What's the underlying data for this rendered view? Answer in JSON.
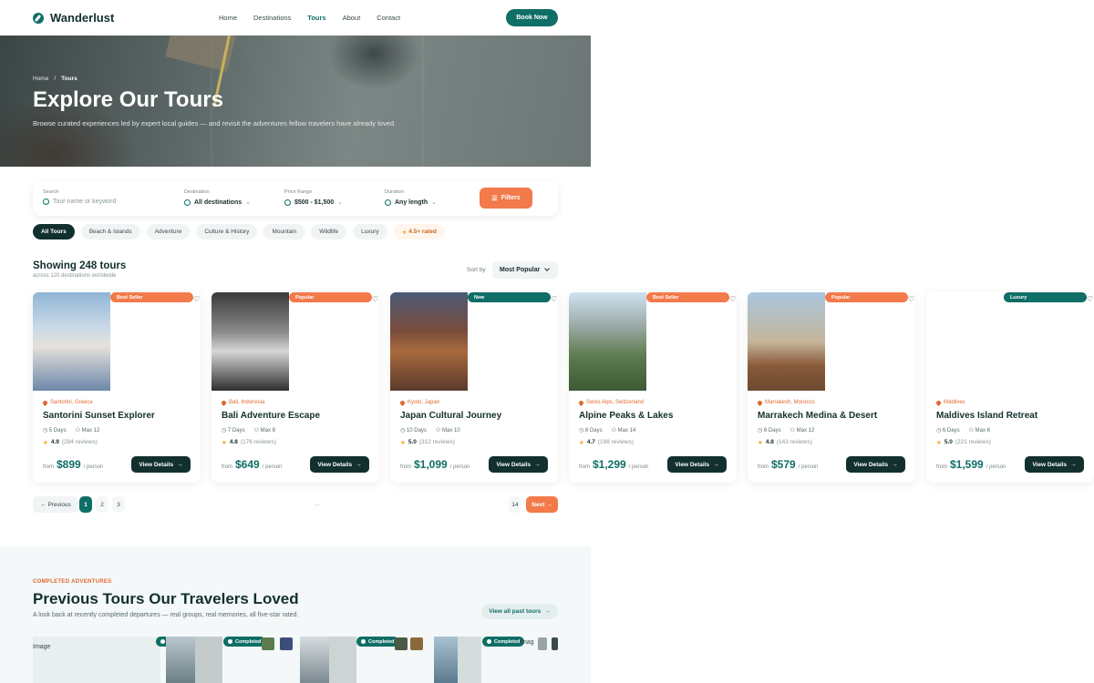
{
  "brand": {
    "name": "Wanderlust"
  },
  "nav": {
    "items": [
      "Home",
      "Destinations",
      "Tours",
      "About",
      "Contact"
    ],
    "active": "Tours",
    "book_label": "Book Now"
  },
  "hero": {
    "breadcrumb": [
      "Home",
      "Tours"
    ],
    "title": "Explore Our Tours",
    "subtitle": "Browse curated experiences led by expert local guides — and revisit the adventures fellow travelers have already loved."
  },
  "search": {
    "search_label": "Search",
    "search_placeholder": "Tour name or keyword",
    "destination_label": "Destination",
    "destination_value": "All destinations",
    "price_label": "Price Range",
    "price_value": "$500 - $1,500",
    "duration_label": "Duration",
    "duration_value": "Any length",
    "filters_label": "Filters"
  },
  "chips": [
    "All Tours",
    "Beach & Islands",
    "Adventure",
    "Culture & History",
    "Mountain",
    "Wildlife",
    "Luxury"
  ],
  "rated_chip": "4.5+ rated",
  "results": {
    "title": "Showing 248 tours",
    "subtitle": "across 120 destinations worldwide",
    "sort_label": "Sort by",
    "sort_value": "Most Popular"
  },
  "tours": [
    {
      "badge": "Best Seller",
      "location": "Santorini, Greece",
      "name": "Santorini Sunset Explorer",
      "days": "5 Days",
      "group": "Max 12",
      "rating": "4.9",
      "reviews": "(284 reviews)",
      "price_from": "from",
      "price": "$899",
      "per": "/ person",
      "cta": "View Details"
    },
    {
      "badge": "Popular",
      "location": "Bali, Indonesia",
      "name": "Bali Adventure Escape",
      "days": "7 Days",
      "group": "Max 8",
      "rating": "4.8",
      "reviews": "(176 reviews)",
      "price_from": "from",
      "price": "$649",
      "per": "/ person",
      "cta": "View Details"
    },
    {
      "badge": "New",
      "location": "Kyoto, Japan",
      "name": "Japan Cultural Journey",
      "days": "10 Days",
      "group": "Max 10",
      "rating": "5.0",
      "reviews": "(312 reviews)",
      "price_from": "from",
      "price": "$1,099",
      "per": "/ person",
      "cta": "View Details"
    },
    {
      "badge": "Best Seller",
      "location": "Swiss Alps, Switzerland",
      "name": "Alpine Peaks & Lakes",
      "days": "8 Days",
      "group": "Max 14",
      "rating": "4.7",
      "reviews": "(198 reviews)",
      "price_from": "from",
      "price": "$1,299",
      "per": "/ person",
      "cta": "View Details"
    },
    {
      "badge": "Popular",
      "location": "Marrakesh, Morocco",
      "name": "Marrakech Medina & Desert",
      "days": "6 Days",
      "group": "Max 12",
      "rating": "4.8",
      "reviews": "(143 reviews)",
      "price_from": "from",
      "price": "$579",
      "per": "/ person",
      "cta": "View Details"
    },
    {
      "badge": "Luxury",
      "location": "Maldives",
      "name": "Maldives Island Retreat",
      "days": "6 Days",
      "group": "Max 6",
      "rating": "5.0",
      "reviews": "(221 reviews)",
      "price_from": "from",
      "price": "$1,599",
      "per": "/ person",
      "cta": "View Details"
    }
  ],
  "pagination": {
    "previous": "Previous",
    "pages": [
      "1",
      "2",
      "3"
    ],
    "ellipsis": "...",
    "last": "14",
    "next": "Next",
    "current": "1"
  },
  "past": {
    "eyebrow": "COMPLETED ADVENTURES",
    "title": "Previous Tours Our Travelers Loved",
    "subtitle": "A look back at recently completed departures — real groups, real memories, all five-star rated.",
    "view_all": "View all past tours",
    "image_alt": "Image",
    "image_alt_short": "Imag",
    "completed_label": "Completed"
  },
  "colors": {
    "primary": "#0f6e66",
    "accent": "#f37a4a",
    "dark": "#12302e"
  }
}
